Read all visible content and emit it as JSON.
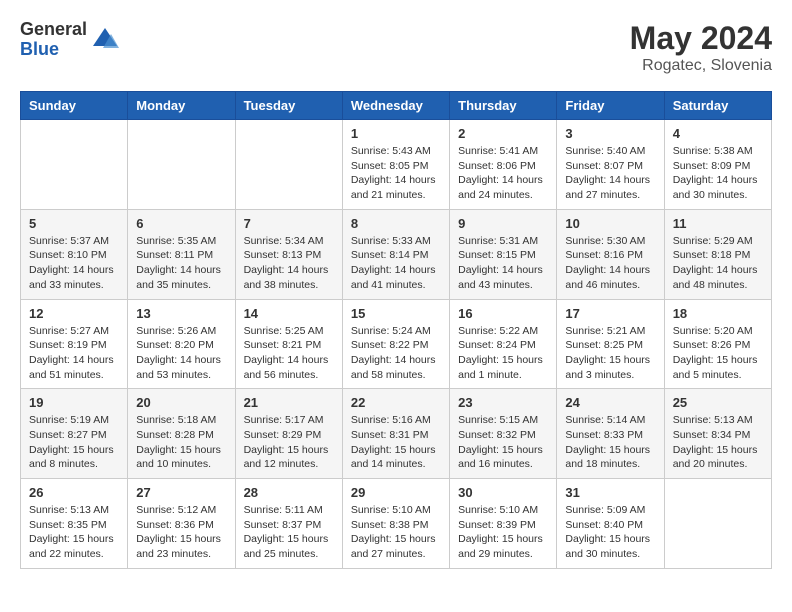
{
  "logo": {
    "general": "General",
    "blue": "Blue"
  },
  "header": {
    "month_year": "May 2024",
    "location": "Rogatec, Slovenia"
  },
  "weekdays": [
    "Sunday",
    "Monday",
    "Tuesday",
    "Wednesday",
    "Thursday",
    "Friday",
    "Saturday"
  ],
  "weeks": [
    [
      null,
      null,
      null,
      {
        "day": "1",
        "sunrise": "5:43 AM",
        "sunset": "8:05 PM",
        "daylight": "14 hours and 21 minutes."
      },
      {
        "day": "2",
        "sunrise": "5:41 AM",
        "sunset": "8:06 PM",
        "daylight": "14 hours and 24 minutes."
      },
      {
        "day": "3",
        "sunrise": "5:40 AM",
        "sunset": "8:07 PM",
        "daylight": "14 hours and 27 minutes."
      },
      {
        "day": "4",
        "sunrise": "5:38 AM",
        "sunset": "8:09 PM",
        "daylight": "14 hours and 30 minutes."
      }
    ],
    [
      {
        "day": "5",
        "sunrise": "5:37 AM",
        "sunset": "8:10 PM",
        "daylight": "14 hours and 33 minutes."
      },
      {
        "day": "6",
        "sunrise": "5:35 AM",
        "sunset": "8:11 PM",
        "daylight": "14 hours and 35 minutes."
      },
      {
        "day": "7",
        "sunrise": "5:34 AM",
        "sunset": "8:13 PM",
        "daylight": "14 hours and 38 minutes."
      },
      {
        "day": "8",
        "sunrise": "5:33 AM",
        "sunset": "8:14 PM",
        "daylight": "14 hours and 41 minutes."
      },
      {
        "day": "9",
        "sunrise": "5:31 AM",
        "sunset": "8:15 PM",
        "daylight": "14 hours and 43 minutes."
      },
      {
        "day": "10",
        "sunrise": "5:30 AM",
        "sunset": "8:16 PM",
        "daylight": "14 hours and 46 minutes."
      },
      {
        "day": "11",
        "sunrise": "5:29 AM",
        "sunset": "8:18 PM",
        "daylight": "14 hours and 48 minutes."
      }
    ],
    [
      {
        "day": "12",
        "sunrise": "5:27 AM",
        "sunset": "8:19 PM",
        "daylight": "14 hours and 51 minutes."
      },
      {
        "day": "13",
        "sunrise": "5:26 AM",
        "sunset": "8:20 PM",
        "daylight": "14 hours and 53 minutes."
      },
      {
        "day": "14",
        "sunrise": "5:25 AM",
        "sunset": "8:21 PM",
        "daylight": "14 hours and 56 minutes."
      },
      {
        "day": "15",
        "sunrise": "5:24 AM",
        "sunset": "8:22 PM",
        "daylight": "14 hours and 58 minutes."
      },
      {
        "day": "16",
        "sunrise": "5:22 AM",
        "sunset": "8:24 PM",
        "daylight": "15 hours and 1 minute."
      },
      {
        "day": "17",
        "sunrise": "5:21 AM",
        "sunset": "8:25 PM",
        "daylight": "15 hours and 3 minutes."
      },
      {
        "day": "18",
        "sunrise": "5:20 AM",
        "sunset": "8:26 PM",
        "daylight": "15 hours and 5 minutes."
      }
    ],
    [
      {
        "day": "19",
        "sunrise": "5:19 AM",
        "sunset": "8:27 PM",
        "daylight": "15 hours and 8 minutes."
      },
      {
        "day": "20",
        "sunrise": "5:18 AM",
        "sunset": "8:28 PM",
        "daylight": "15 hours and 10 minutes."
      },
      {
        "day": "21",
        "sunrise": "5:17 AM",
        "sunset": "8:29 PM",
        "daylight": "15 hours and 12 minutes."
      },
      {
        "day": "22",
        "sunrise": "5:16 AM",
        "sunset": "8:31 PM",
        "daylight": "15 hours and 14 minutes."
      },
      {
        "day": "23",
        "sunrise": "5:15 AM",
        "sunset": "8:32 PM",
        "daylight": "15 hours and 16 minutes."
      },
      {
        "day": "24",
        "sunrise": "5:14 AM",
        "sunset": "8:33 PM",
        "daylight": "15 hours and 18 minutes."
      },
      {
        "day": "25",
        "sunrise": "5:13 AM",
        "sunset": "8:34 PM",
        "daylight": "15 hours and 20 minutes."
      }
    ],
    [
      {
        "day": "26",
        "sunrise": "5:13 AM",
        "sunset": "8:35 PM",
        "daylight": "15 hours and 22 minutes."
      },
      {
        "day": "27",
        "sunrise": "5:12 AM",
        "sunset": "8:36 PM",
        "daylight": "15 hours and 23 minutes."
      },
      {
        "day": "28",
        "sunrise": "5:11 AM",
        "sunset": "8:37 PM",
        "daylight": "15 hours and 25 minutes."
      },
      {
        "day": "29",
        "sunrise": "5:10 AM",
        "sunset": "8:38 PM",
        "daylight": "15 hours and 27 minutes."
      },
      {
        "day": "30",
        "sunrise": "5:10 AM",
        "sunset": "8:39 PM",
        "daylight": "15 hours and 29 minutes."
      },
      {
        "day": "31",
        "sunrise": "5:09 AM",
        "sunset": "8:40 PM",
        "daylight": "15 hours and 30 minutes."
      },
      null
    ]
  ],
  "labels": {
    "sunrise": "Sunrise:",
    "sunset": "Sunset:",
    "daylight": "Daylight:"
  }
}
